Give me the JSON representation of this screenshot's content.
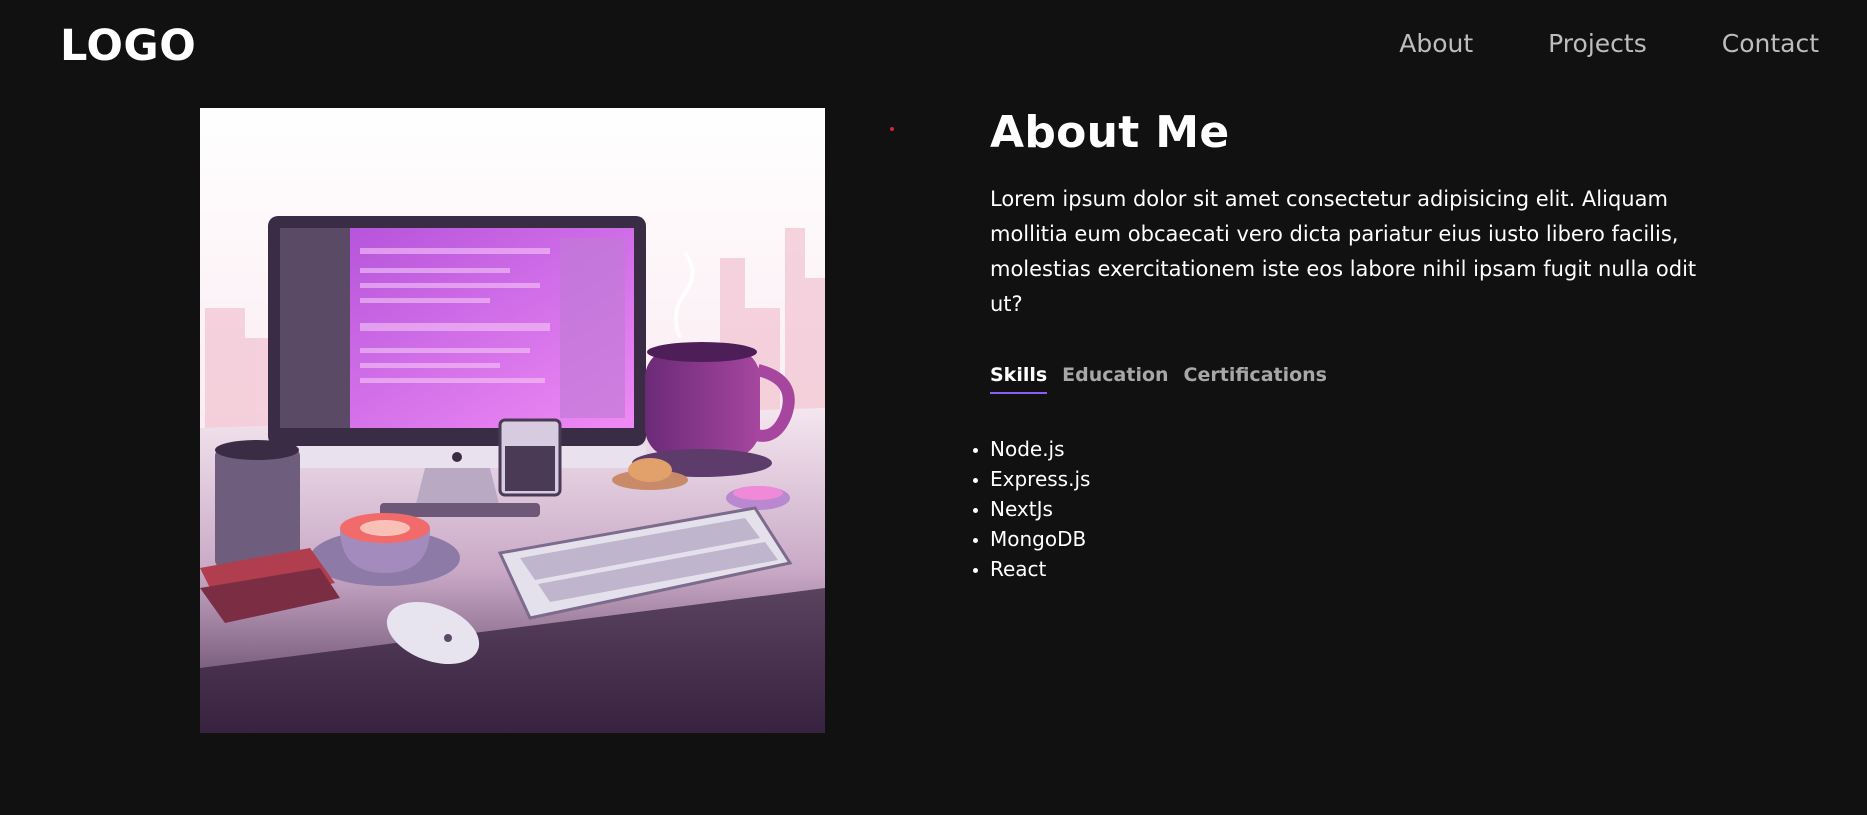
{
  "header": {
    "logo": "LOGO",
    "nav": [
      "About",
      "Projects",
      "Contact"
    ]
  },
  "about": {
    "title": "About Me",
    "description": "Lorem ipsum dolor sit amet consectetur adipisicing elit. Aliquam mollitia eum obcaecati vero dicta pariatur eius iusto libero facilis, molestias exercitationem iste eos labore nihil ipsam fugit nulla odit ut?",
    "tabs": [
      "Skills",
      "Education",
      "Certifications"
    ],
    "active_tab": "Skills",
    "skills": [
      "Node.js",
      "Express.js",
      "NextJs",
      "MongoDB",
      "React"
    ]
  },
  "colors": {
    "background": "#111111",
    "nav_text": "#bdbdbd",
    "tab_inactive": "#a7a7a7",
    "tab_underline": "#8b5cf6",
    "dot": "#d3262b"
  }
}
